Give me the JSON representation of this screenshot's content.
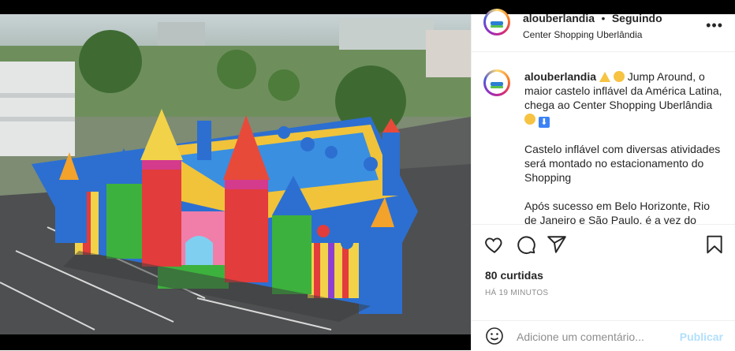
{
  "post": {
    "username": "alouberlandia",
    "separator": "•",
    "follow_status": "Seguindo",
    "location": "Center Shopping Uberlândia",
    "more_label": "•••",
    "caption_username": "alouberlandia",
    "caption_line1": "Jump Around, o maior castelo inflável da América Latina, chega ao Center Shopping Uberlândia",
    "caption_para2": "Castelo inflável com diversas atividades será montado no estacionamento do Shopping",
    "caption_para3": "Após sucesso em Belo Horizonte, Rio de Janeiro e São Paulo, é a vez do Center",
    "likes": "80 curtidas",
    "time": "HÁ 19 MINUTOS",
    "comment_placeholder": "Adicione um comentário...",
    "publish_label": "Publicar"
  },
  "icons": {
    "like": "heart-icon",
    "comment": "comment-icon",
    "share": "share-icon",
    "save": "bookmark-icon",
    "emoji": "emoji-icon"
  },
  "colors": {
    "publish_disabled": "#b2dffc",
    "muted": "#8e8e8e",
    "text": "#262626"
  }
}
